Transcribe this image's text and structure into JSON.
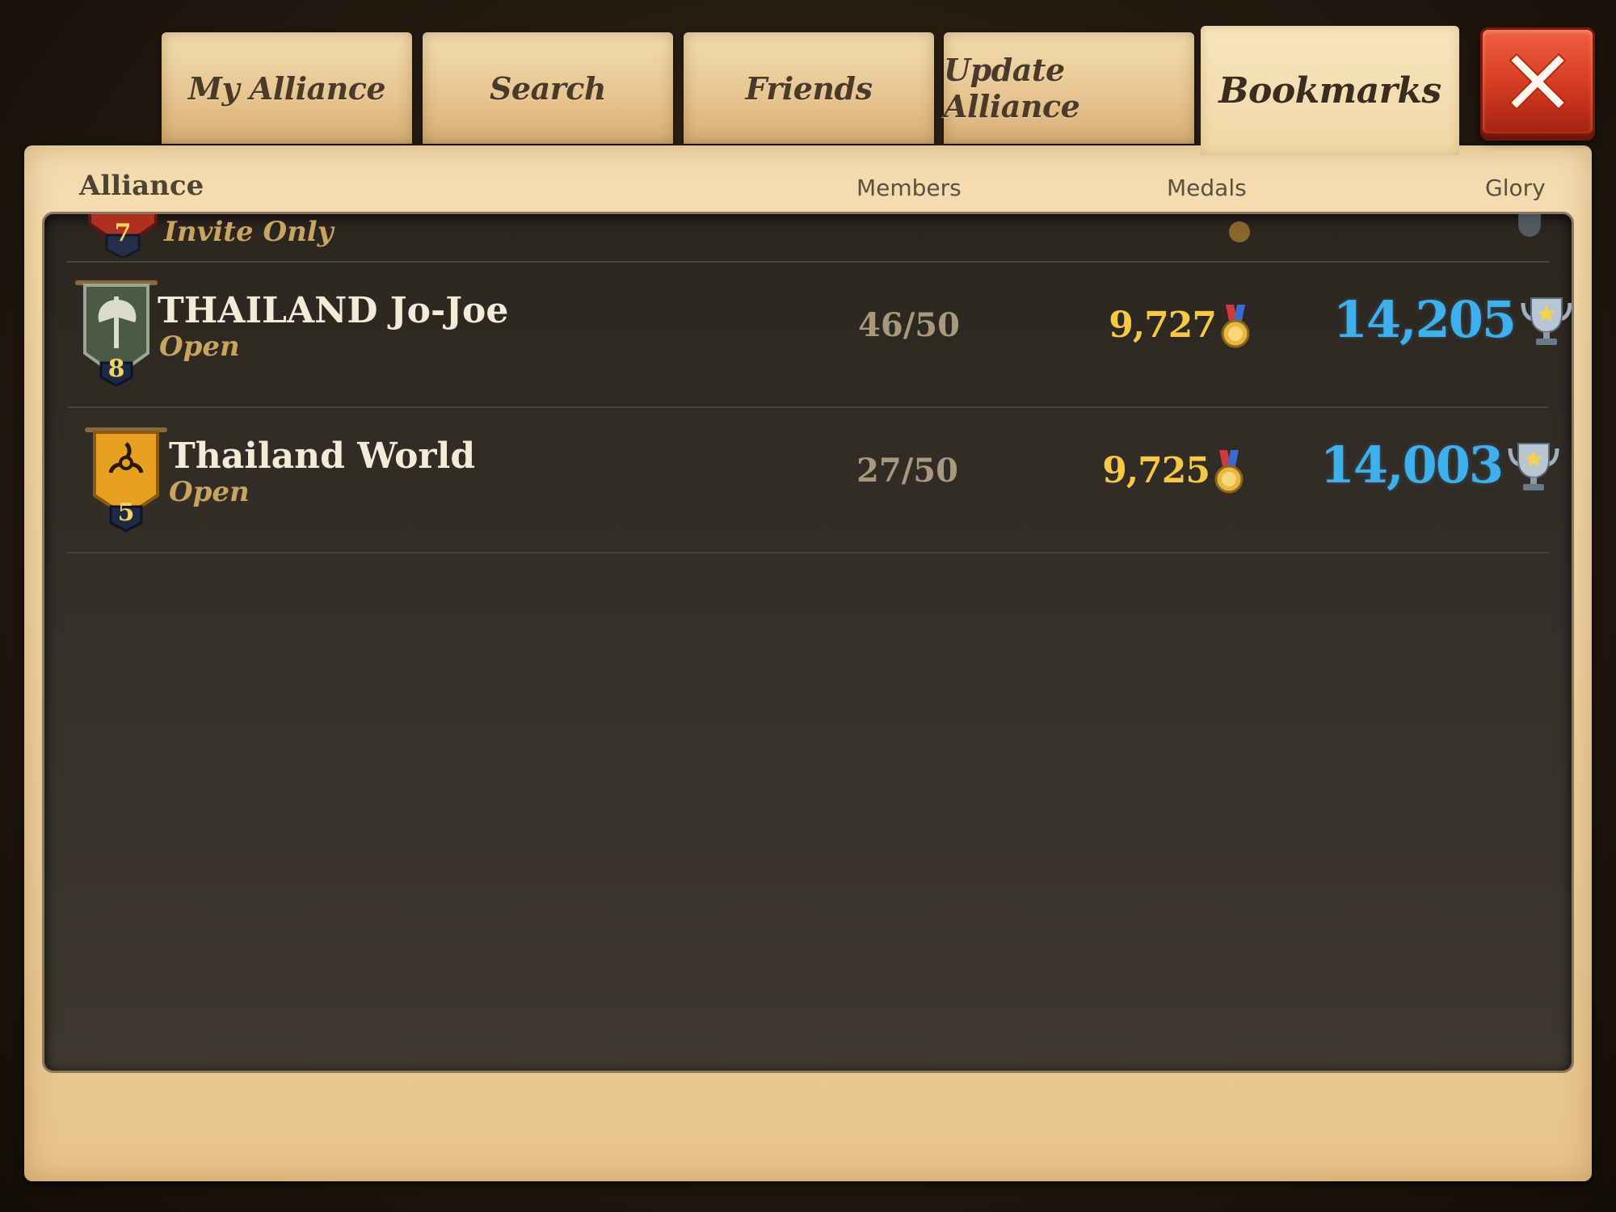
{
  "tabs": [
    {
      "label": "My Alliance"
    },
    {
      "label": "Search"
    },
    {
      "label": "Friends"
    },
    {
      "label": "Update Alliance"
    },
    {
      "label": "Bookmarks"
    }
  ],
  "columns": {
    "alliance": "Alliance",
    "members": "Members",
    "medals": "Medals",
    "glory": "Glory"
  },
  "rows": [
    {
      "name": "",
      "status": "Invite Only",
      "members": "",
      "medals": "",
      "glory": "",
      "rank": "7",
      "banner_color": "#b03020"
    },
    {
      "name": "THAILAND Jo-Joe",
      "status": "Open",
      "members": "46/50",
      "medals": "9,727",
      "glory": "14,205",
      "rank": "8",
      "banner_color": "#4a5a46"
    },
    {
      "name": "Thailand World",
      "status": "Open",
      "members": "27/50",
      "medals": "9,725",
      "glory": "14,003",
      "rank": "5",
      "banner_color": "#e8a020"
    }
  ],
  "colors": {
    "medal_text": "#f7c843",
    "glory_text": "#3fb0ee",
    "close_button": "#d43a22"
  },
  "icons": {
    "close": "close-x-icon",
    "medal": "medal-icon",
    "glory": "trophy-icon",
    "axe": "axe-emblem-icon",
    "biohazard": "biohazard-emblem-icon"
  }
}
